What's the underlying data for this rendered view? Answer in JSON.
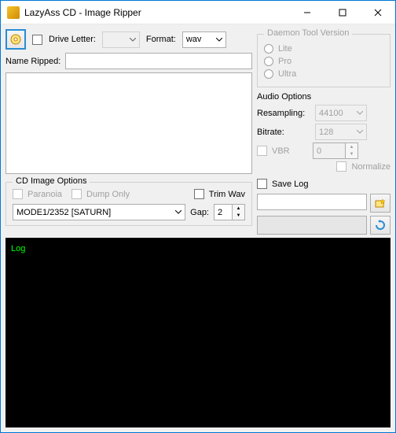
{
  "window": {
    "title": "LazyAss CD - Image Ripper"
  },
  "top": {
    "drive_letter_label": "Drive Letter:",
    "drive_letter_value": "",
    "format_label": "Format:",
    "format_value": "wav",
    "name_ripped_label": "Name Ripped:",
    "name_ripped_value": ""
  },
  "daemon": {
    "legend": "Daemon Tool Version",
    "lite": "Lite",
    "pro": "Pro",
    "ultra": "Ultra"
  },
  "audio": {
    "legend": "Audio Options",
    "resampling_label": "Resampling:",
    "resampling_value": "44100",
    "bitrate_label": "Bitrate:",
    "bitrate_value": "128",
    "vbr_label": "VBR",
    "vbr_value": "0",
    "normalize_label": "Normalize"
  },
  "cd": {
    "legend": "CD Image Options",
    "paranoia_label": "Paranoia",
    "dump_only_label": "Dump Only",
    "trim_wav_label": "Trim Wav",
    "mode_value": "MODE1/2352 [SATURN]",
    "gap_label": "Gap:",
    "gap_value": "2"
  },
  "savelog": {
    "label": "Save Log",
    "path": ""
  },
  "log": {
    "header": "Log"
  }
}
